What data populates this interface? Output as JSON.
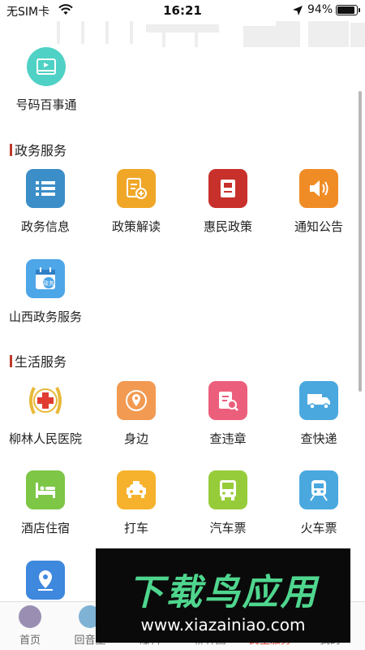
{
  "status_bar": {
    "carrier": "无SIM卡",
    "time": "16:21",
    "battery": "94%"
  },
  "top_item": {
    "label": "号码百事通",
    "icon": "video-card-icon",
    "color": "#4fd1c5"
  },
  "sections": {
    "gov": {
      "title": "政务服务",
      "items": [
        {
          "label": "政务信息",
          "icon": "list-icon",
          "color": "#3b8ec7"
        },
        {
          "label": "政策解读",
          "icon": "document-plus-icon",
          "color": "#f0a728"
        },
        {
          "label": "惠民政策",
          "icon": "book-icon",
          "color": "#c8302c"
        },
        {
          "label": "通知公告",
          "icon": "speaker-icon",
          "color": "#f08c25"
        },
        {
          "label": "山西政务服务",
          "icon": "calendar-badge-icon",
          "color": "#4da6e8"
        }
      ]
    },
    "life": {
      "title": "生活服务",
      "items": [
        {
          "label": "柳林人民医院",
          "icon": "hospital-cross-icon",
          "color": "#e03c31"
        },
        {
          "label": "身边",
          "icon": "location-pin-icon",
          "color": "#f29a52"
        },
        {
          "label": "查违章",
          "icon": "clipboard-search-icon",
          "color": "#ec5f7c"
        },
        {
          "label": "查快递",
          "icon": "truck-icon",
          "color": "#4aa8df"
        },
        {
          "label": "酒店住宿",
          "icon": "bed-icon",
          "color": "#7dc646"
        },
        {
          "label": "打车",
          "icon": "taxi-icon",
          "color": "#f6b22c"
        },
        {
          "label": "汽车票",
          "icon": "bus-icon",
          "color": "#96cc3a"
        },
        {
          "label": "火车票",
          "icon": "train-icon",
          "color": "#4aa8df"
        },
        {
          "label": "",
          "icon": "map-pin-icon",
          "color": "#3e88dd"
        }
      ]
    }
  },
  "tabbar": {
    "items": [
      {
        "label": "首页"
      },
      {
        "label": "回音壁"
      },
      {
        "label": "爆料"
      },
      {
        "label": "柳林圈"
      },
      {
        "label": "民生服务"
      },
      {
        "label": "我的"
      }
    ]
  },
  "watermark": {
    "title": "下载鸟应用",
    "url": "www.xiazainiao.com"
  }
}
